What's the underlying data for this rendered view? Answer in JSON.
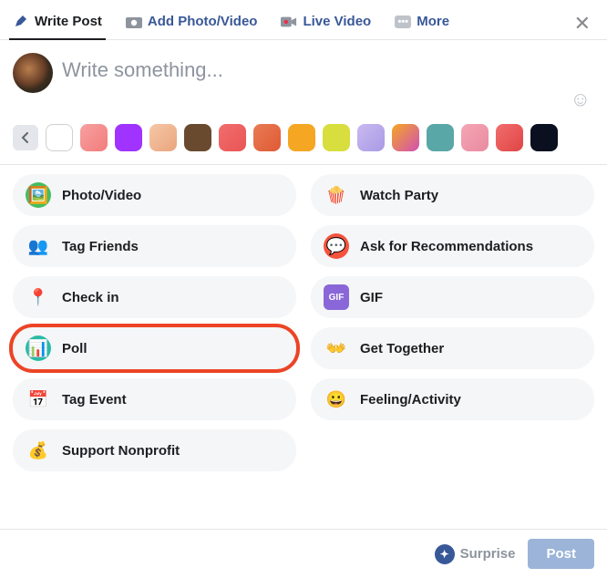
{
  "tabs": {
    "write": "Write Post",
    "photo": "Add Photo/Video",
    "live": "Live Video",
    "more": "More"
  },
  "composer": {
    "placeholder": "Write something..."
  },
  "swatches": [
    "blank",
    "linear-gradient(135deg,#f7a0a0,#f37c7c)",
    "#a033ff",
    "linear-gradient(135deg,#f6c7a6,#e9a57e)",
    "#6a4a2f",
    "linear-gradient(135deg,#f26d6d,#e95555)",
    "linear-gradient(135deg,#e97b55,#df5a34)",
    "#f5a623",
    "#d8de3e",
    "linear-gradient(135deg,#c9b9f0,#a99ae6)",
    "linear-gradient(135deg,#f5a623,#d150b4)",
    "#5aa7a7",
    "linear-gradient(135deg,#f5a6b5,#e98aa0)",
    "linear-gradient(135deg,#f26d6d,#e04545)",
    "#0b1020"
  ],
  "options": {
    "left": [
      {
        "key": "photo_video",
        "label": "Photo/Video",
        "icon": "photo",
        "bg": "#45bd62",
        "fg": "#fff",
        "glyph": "🖼️"
      },
      {
        "key": "tag_friends",
        "label": "Tag Friends",
        "icon": "tag-friends",
        "bg": "transparent",
        "fg": "#1877f2",
        "glyph": "👥"
      },
      {
        "key": "check_in",
        "label": "Check in",
        "icon": "pin",
        "bg": "transparent",
        "fg": "#f5533d",
        "glyph": "📍"
      },
      {
        "key": "poll",
        "label": "Poll",
        "icon": "poll",
        "bg": "#2abba7",
        "fg": "#fff",
        "glyph": "📊",
        "highlight": true
      },
      {
        "key": "tag_event",
        "label": "Tag Event",
        "icon": "calendar",
        "bg": "transparent",
        "fg": "#f5533d",
        "glyph": "📅"
      },
      {
        "key": "support_nonprofit",
        "label": "Support Nonprofit",
        "icon": "coin",
        "bg": "transparent",
        "fg": "#f7b928",
        "glyph": "💰"
      }
    ],
    "right": [
      {
        "key": "watch_party",
        "label": "Watch Party",
        "icon": "popcorn",
        "bg": "transparent",
        "fg": "#f5533d",
        "glyph": "🍿"
      },
      {
        "key": "ask_rec",
        "label": "Ask for Recommendations",
        "icon": "rec",
        "bg": "#f5533d",
        "fg": "#fff",
        "glyph": "💬"
      },
      {
        "key": "gif",
        "label": "GIF",
        "icon": "gif",
        "bg": "#8a67d8",
        "fg": "#fff",
        "glyph": "GIF",
        "small": true
      },
      {
        "key": "get_together",
        "label": "Get Together",
        "icon": "hands",
        "bg": "transparent",
        "fg": "#1877f2",
        "glyph": "👐"
      },
      {
        "key": "feeling",
        "label": "Feeling/Activity",
        "icon": "smile",
        "bg": "transparent",
        "fg": "#f7b928",
        "glyph": "😀"
      }
    ]
  },
  "footer": {
    "surprise": "Surprise",
    "post": "Post"
  }
}
